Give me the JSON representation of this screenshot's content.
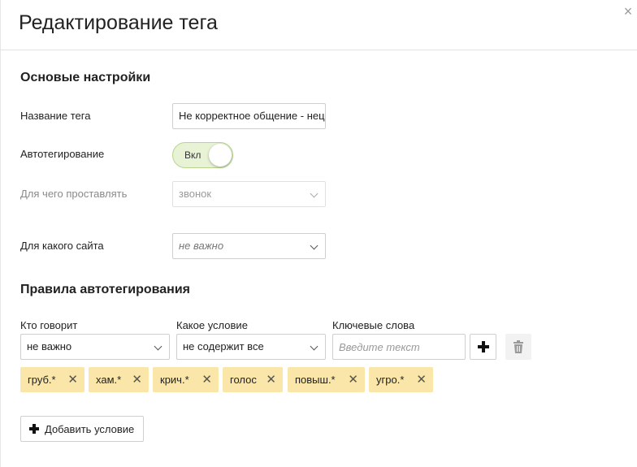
{
  "dialog": {
    "title": "Редактирование тега",
    "close_icon": "×"
  },
  "basic": {
    "section_title": "Основые настройки",
    "tag_name_label": "Название тега",
    "tag_name_value": "Не корректное общение - нецензурная лексика",
    "autotag_label": "Автотегирование",
    "autotag_toggle": {
      "state": "on",
      "label": "Вкл"
    },
    "apply_to_label": "Для чего проставлять",
    "apply_to_value": "звонок",
    "site_label": "Для какого сайта",
    "site_value": "не важно"
  },
  "rules": {
    "section_title": "Правила автотегирования",
    "who_label": "Кто говорит",
    "who_value": "не важно",
    "condition_label": "Какое условие",
    "condition_value": "не содержит все",
    "keywords_label": "Ключевые слова",
    "keywords_placeholder": "Введите текст",
    "keywords": [
      {
        "text": "груб.*"
      },
      {
        "text": "хам.*"
      },
      {
        "text": "крич.*"
      },
      {
        "text": "голос"
      },
      {
        "text": "повыш.*"
      },
      {
        "text": "угро.*"
      }
    ],
    "remove_chip_icon": "✕",
    "add_condition_label": "Добавить условие"
  },
  "colors": {
    "chip_bg": "#f9e6a8",
    "toggle_bg": "#e8f3d6"
  }
}
